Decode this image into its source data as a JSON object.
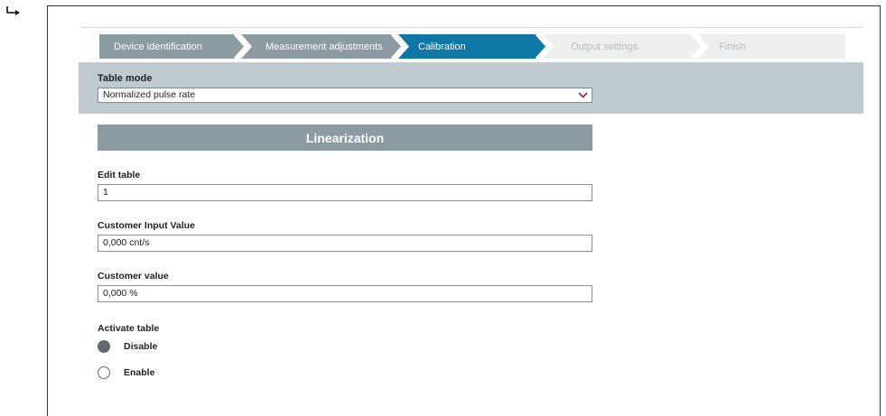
{
  "wizard": {
    "steps": [
      {
        "label": "Device identification",
        "state": "done"
      },
      {
        "label": "Measurement adjustments",
        "state": "done"
      },
      {
        "label": "Calibration",
        "state": "active"
      },
      {
        "label": "Output settings",
        "state": "todo"
      },
      {
        "label": "Finish",
        "state": "todo"
      }
    ]
  },
  "table_mode": {
    "label": "Table mode",
    "selected": "Normalized pulse rate"
  },
  "section": {
    "title": "Linearization"
  },
  "fields": {
    "edit_table": {
      "label": "Edit table",
      "value": "1"
    },
    "customer_input": {
      "label": "Customer Input Value",
      "value": "0,000 cnt/s"
    },
    "customer_value": {
      "label": "Customer value",
      "value": "0,000 %"
    }
  },
  "activate": {
    "label": "Activate table",
    "options": [
      {
        "label": "Disable",
        "selected": true
      },
      {
        "label": "Enable",
        "selected": false
      }
    ]
  },
  "colors": {
    "step_done": "#8c9aa1",
    "step_active": "#0f77a6",
    "step_todo": "#eceeef",
    "band": "#bfcbd0",
    "chevron": "#a0185a"
  }
}
